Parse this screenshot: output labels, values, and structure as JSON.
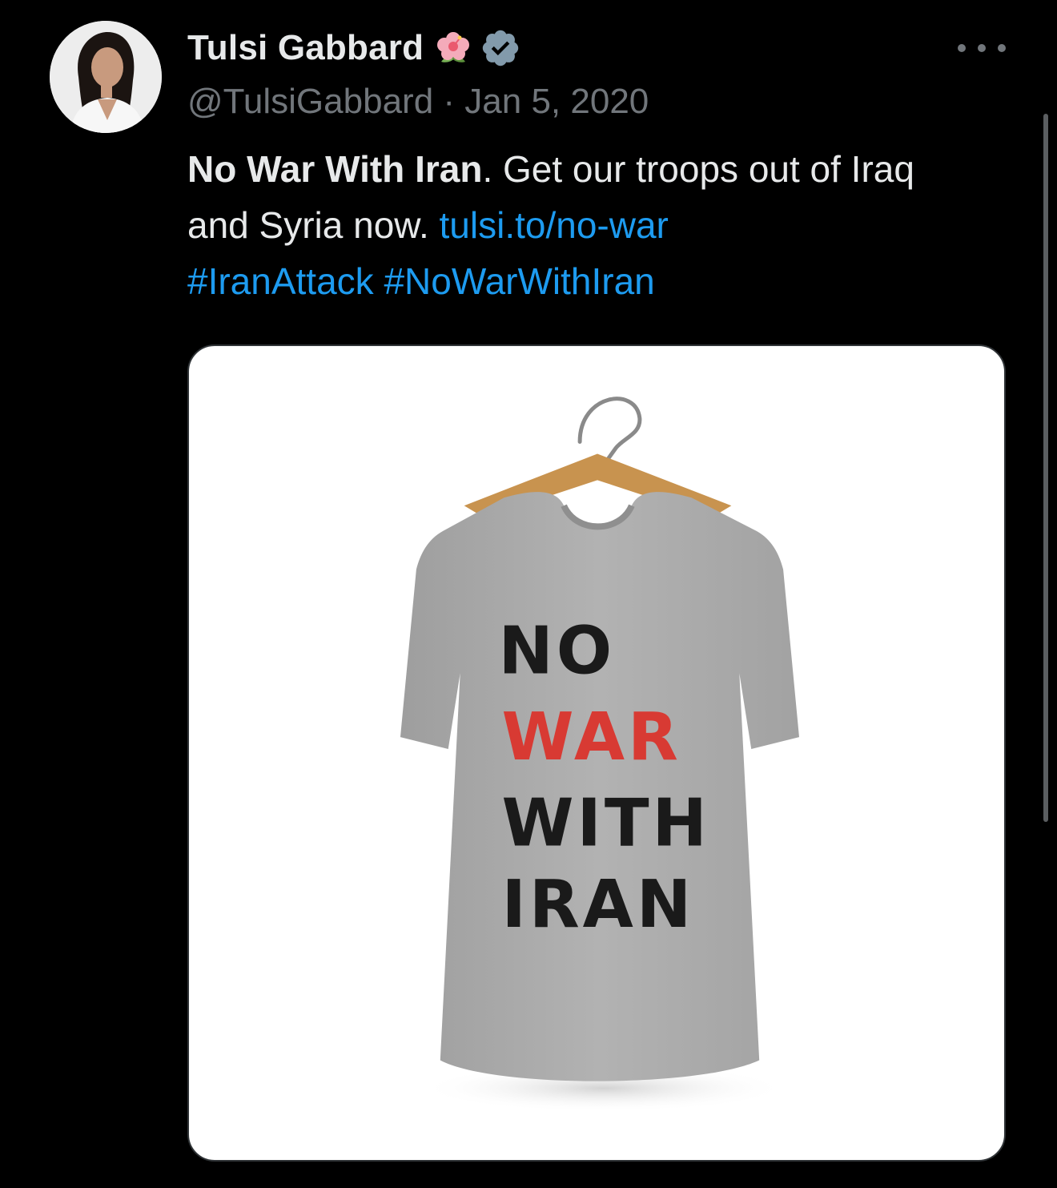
{
  "author": {
    "display_name": "Tulsi Gabbard",
    "handle": "@TulsiGabbard",
    "separator": "·",
    "date": "Jan 5, 2020",
    "badges": [
      "hibiscus-flower-icon",
      "verified-badge-icon"
    ]
  },
  "tweet": {
    "bold_text": "No War With Iran",
    "text_after_bold": ". Get our troops out of Iraq and Syria now. ",
    "link": "tulsi.to/no-war",
    "hashtags": [
      "#IranAttack",
      "#NoWarWithIran"
    ]
  },
  "media": {
    "shirt_lines": [
      "NO",
      "WAR",
      "WITH",
      "IRAN"
    ]
  },
  "colors": {
    "background": "#000000",
    "text_primary": "#e7e9ea",
    "text_secondary": "#71767b",
    "link": "#1d9bf0",
    "shirt_gray": "#a9a9a9",
    "accent_red": "#d83a33"
  }
}
